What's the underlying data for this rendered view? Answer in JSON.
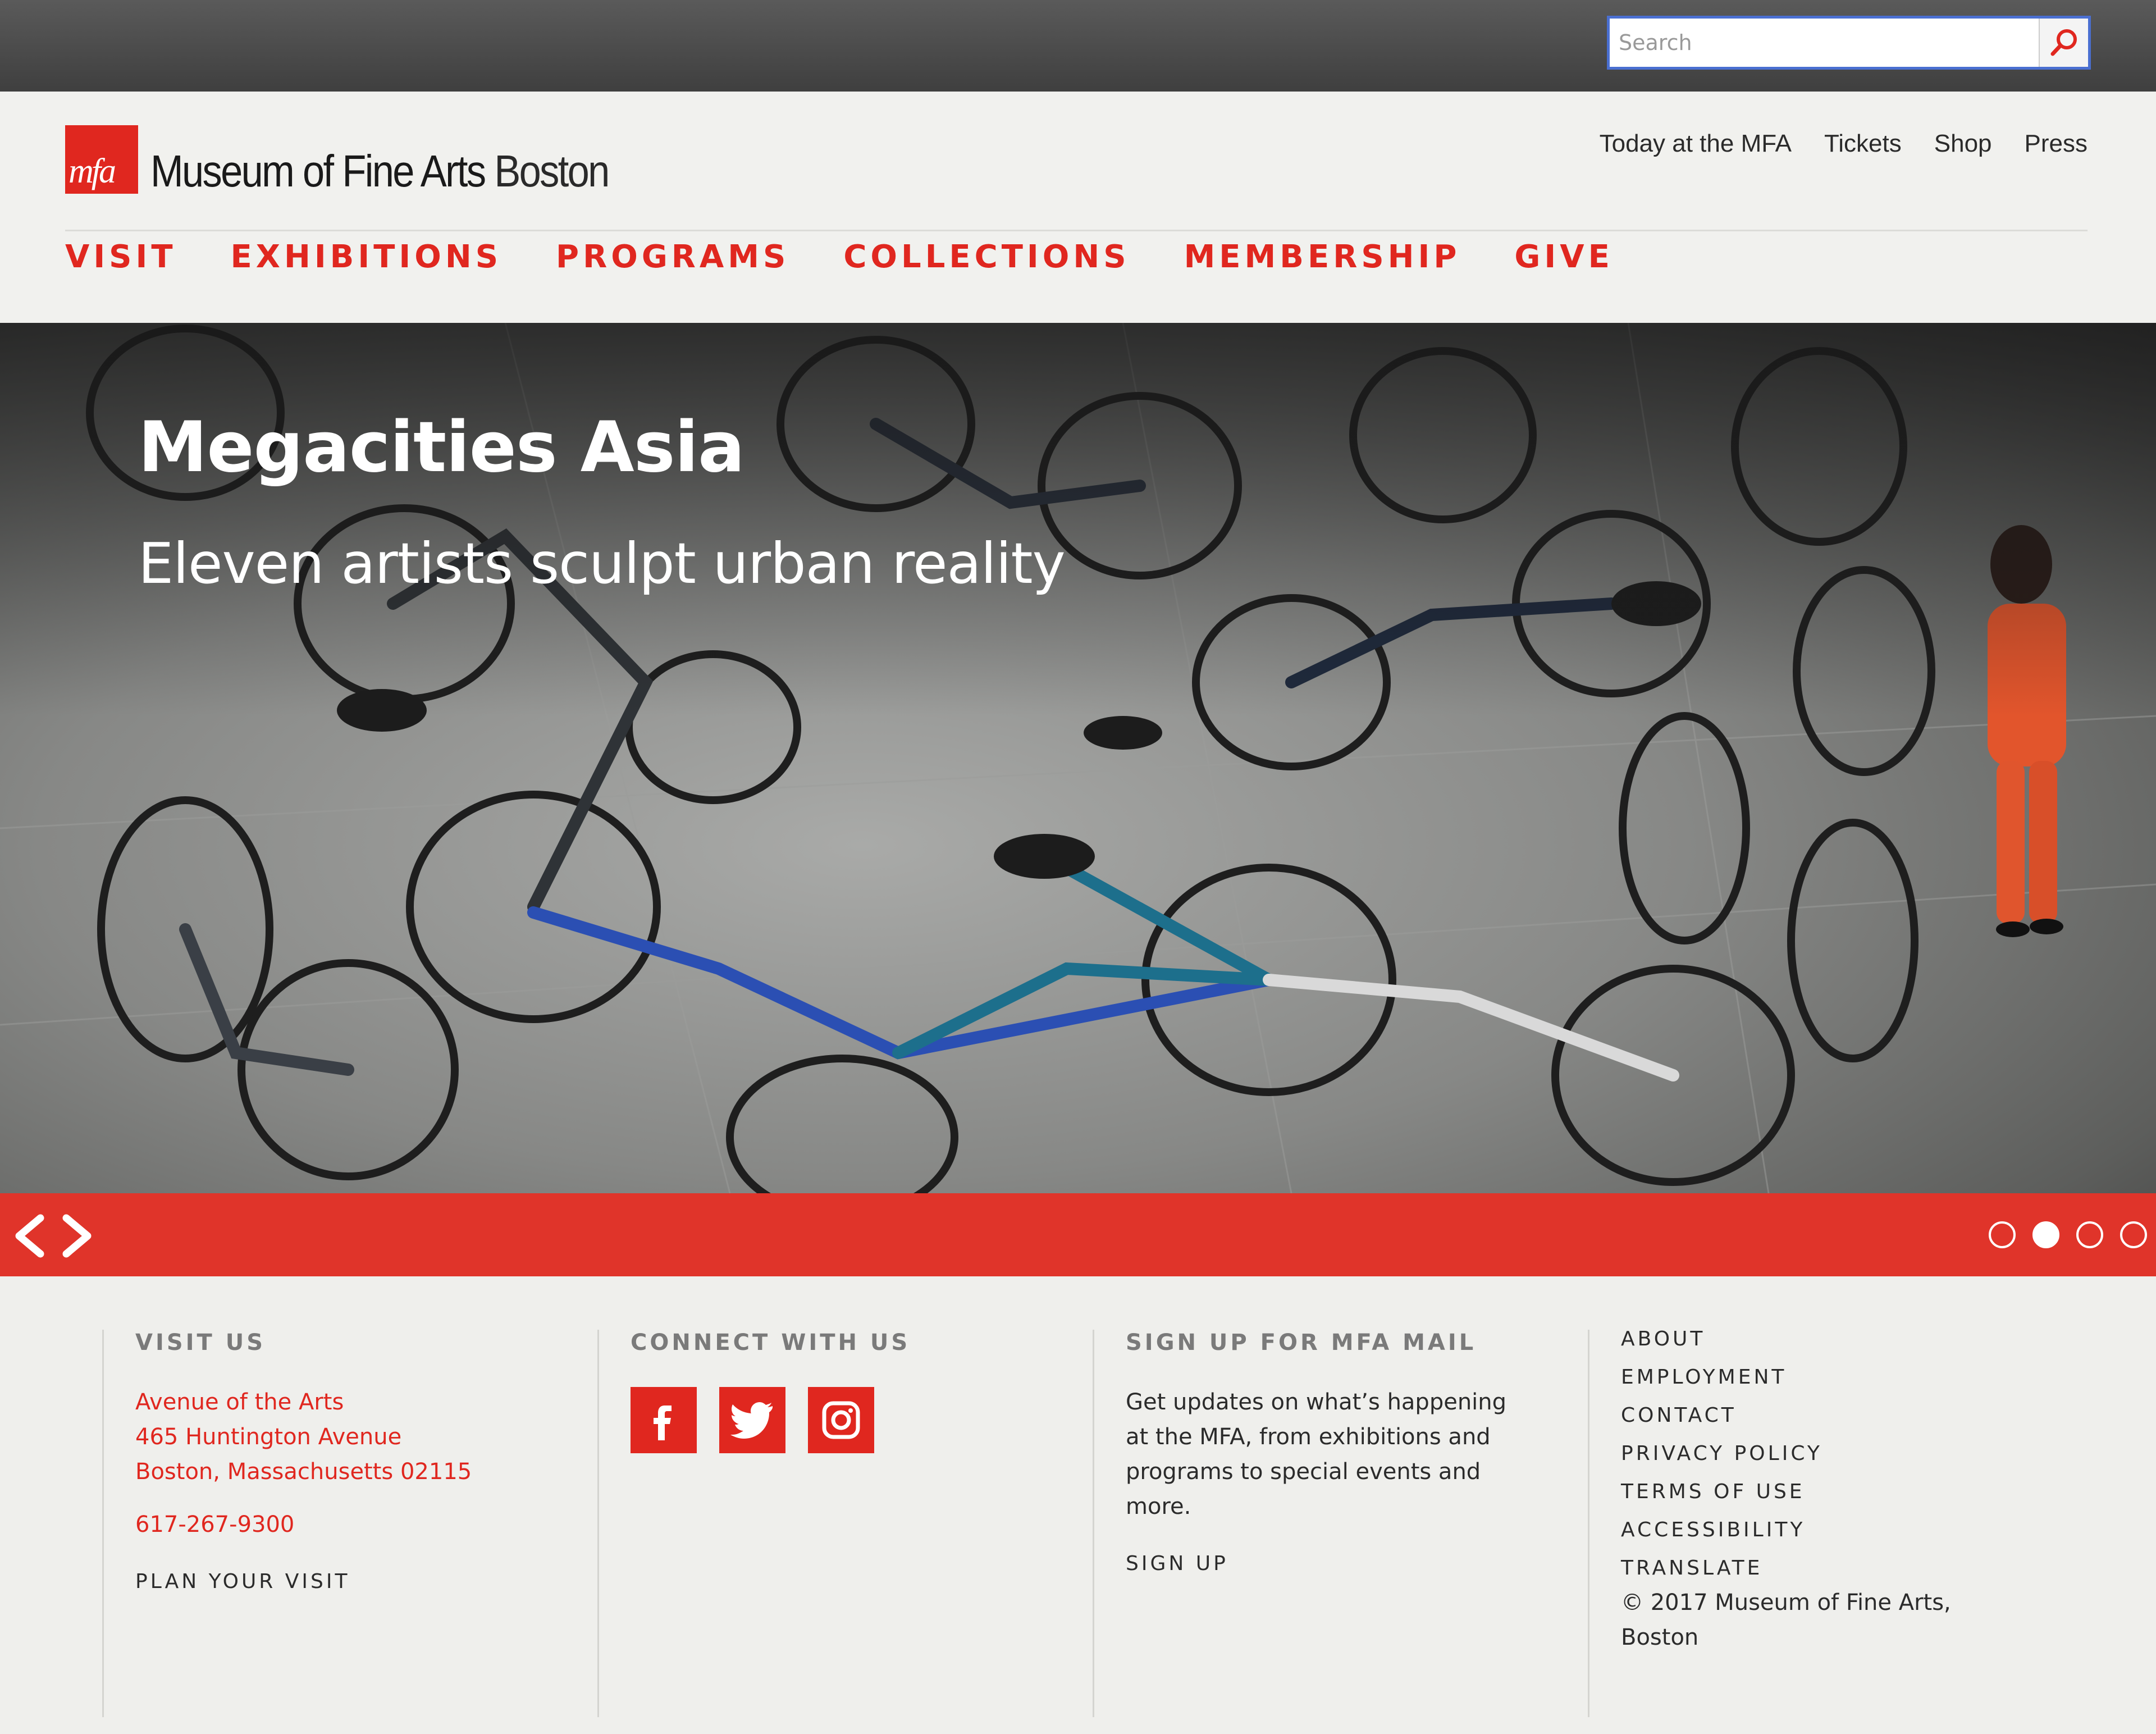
{
  "search": {
    "placeholder": "Search"
  },
  "brand": {
    "mark": "mfa",
    "name": "Museum of Fine Arts",
    "city": "Boston"
  },
  "utility_nav": [
    "Today at the MFA",
    "Tickets",
    "Shop",
    "Press"
  ],
  "main_nav": [
    "VISIT",
    "EXHIBITIONS",
    "PROGRAMS",
    "COLLECTIONS",
    "MEMBERSHIP",
    "GIVE"
  ],
  "hero": {
    "title": "Megacities Asia",
    "subtitle": "Eleven artists sculpt urban reality"
  },
  "carousel": {
    "slide_count": 4,
    "active_slide": 2
  },
  "footer": {
    "visit": {
      "heading": "VISIT US",
      "address": [
        "Avenue of the Arts",
        "465 Huntington Avenue",
        "Boston, Massachusetts 02115"
      ],
      "phone": "617-267-9300",
      "plan_link": "PLAN YOUR VISIT"
    },
    "connect": {
      "heading": "CONNECT WITH US",
      "networks": [
        "facebook-icon",
        "twitter-icon",
        "instagram-icon"
      ]
    },
    "mail": {
      "heading": "SIGN UP FOR MFA MAIL",
      "text": "Get updates on what’s happening at the MFA, from exhibitions and programs to special events and more.",
      "signup_link": "SIGN UP"
    },
    "links": [
      "ABOUT",
      "EMPLOYMENT",
      "CONTACT",
      "PRIVACY POLICY",
      "TERMS OF USE",
      "ACCESSIBILITY",
      "TRANSLATE"
    ],
    "copyright": "© 2017 Museum of Fine Arts, Boston"
  },
  "colors": {
    "brand_red": "#e0271f",
    "carousel_red": "#e0342a",
    "topbar": "#4a4a4a",
    "search_border": "#4a6fd1"
  }
}
